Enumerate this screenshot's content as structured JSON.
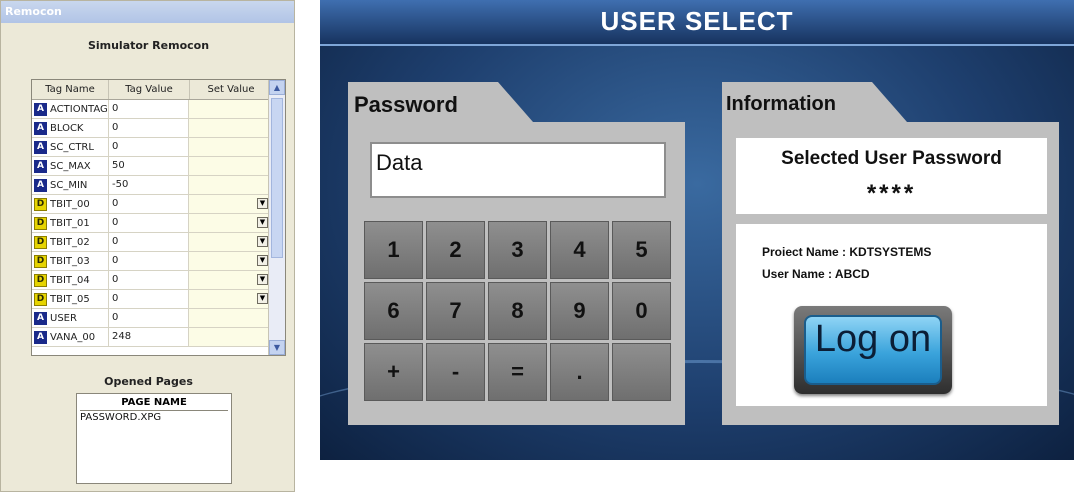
{
  "remocon": {
    "window_title": "Remocon",
    "subtitle": "Simulator Remocon",
    "table": {
      "columns": [
        "Tag Name",
        "Tag Value",
        "Set Value"
      ],
      "rows": [
        {
          "type": "A",
          "name": "ACTIONTAG",
          "value": "0",
          "dropdown": false
        },
        {
          "type": "A",
          "name": "BLOCK",
          "value": "0",
          "dropdown": false
        },
        {
          "type": "A",
          "name": "SC_CTRL",
          "value": "0",
          "dropdown": false
        },
        {
          "type": "A",
          "name": "SC_MAX",
          "value": "50",
          "dropdown": false
        },
        {
          "type": "A",
          "name": "SC_MIN",
          "value": "-50",
          "dropdown": false
        },
        {
          "type": "D",
          "name": "TBIT_00",
          "value": "0",
          "dropdown": true
        },
        {
          "type": "D",
          "name": "TBIT_01",
          "value": "0",
          "dropdown": true
        },
        {
          "type": "D",
          "name": "TBIT_02",
          "value": "0",
          "dropdown": true
        },
        {
          "type": "D",
          "name": "TBIT_03",
          "value": "0",
          "dropdown": true
        },
        {
          "type": "D",
          "name": "TBIT_04",
          "value": "0",
          "dropdown": true
        },
        {
          "type": "D",
          "name": "TBIT_05",
          "value": "0",
          "dropdown": true
        },
        {
          "type": "A",
          "name": "USER",
          "value": "0",
          "dropdown": false
        },
        {
          "type": "A",
          "name": "VANA_00",
          "value": "248",
          "dropdown": false
        }
      ]
    },
    "opened_pages": {
      "title": "Opened Pages",
      "header": "PAGE NAME",
      "items": [
        "PASSWORD.XPG"
      ]
    }
  },
  "hmi": {
    "title": "USER SELECT",
    "password_panel": {
      "tab_label": "Password",
      "input_value": "Data",
      "keys": [
        "1",
        "2",
        "3",
        "4",
        "5",
        "6",
        "7",
        "8",
        "9",
        "0",
        "+",
        "-",
        "=",
        ".",
        ""
      ]
    },
    "info_panel": {
      "tab_label": "Information",
      "selected_label": "Selected User Password",
      "masked_password": "****",
      "project_line": "Proiect Name : KDTSYSTEMS",
      "user_line": "User Name : ABCD",
      "logon_label": "Log on"
    }
  }
}
